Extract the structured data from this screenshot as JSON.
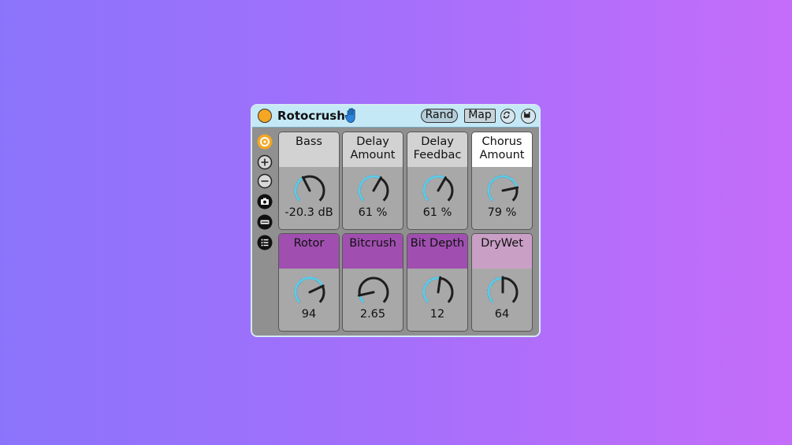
{
  "device": {
    "title": "Rotocrush",
    "rand_label": "Rand",
    "map_label": "Map",
    "icons": {
      "power": "power-button-icon",
      "hand": "hand-icon",
      "refresh": "refresh-icon",
      "save": "save-icon"
    }
  },
  "sidebar": [
    "macro-icon",
    "add-icon",
    "remove-icon",
    "camera-icon",
    "minus-bar-icon",
    "list-icon"
  ],
  "colors": {
    "accent_orange": "#f5a623",
    "titlebar": "#c4e8f6",
    "knob_arc": "#58c8e8",
    "purple": "#a04fb0",
    "light_purple": "#c99fc6",
    "white": "#ffffff",
    "gray": "#d2d2d2"
  },
  "macros": [
    {
      "label": "Bass",
      "value": "-20.3 dB",
      "level": 0.4,
      "header": "#d2d2d2"
    },
    {
      "label": "Delay Amount",
      "value": "61 %",
      "level": 0.61,
      "header": "#d2d2d2"
    },
    {
      "label": "Delay Feedbac",
      "value": "61 %",
      "level": 0.61,
      "header": "#d2d2d2"
    },
    {
      "label": "Chorus Amount",
      "value": "79 %",
      "level": 0.79,
      "header": "#ffffff"
    },
    {
      "label": "Rotor",
      "value": "94",
      "level": 0.74,
      "header": "#a04fb0"
    },
    {
      "label": "Bitcrush",
      "value": "2.65",
      "level": 0.12,
      "header": "#a04fb0"
    },
    {
      "label": "Bit Depth",
      "value": "12",
      "level": 0.53,
      "header": "#a04fb0"
    },
    {
      "label": "DryWet",
      "value": "64",
      "level": 0.5,
      "header": "#c99fc6"
    }
  ]
}
